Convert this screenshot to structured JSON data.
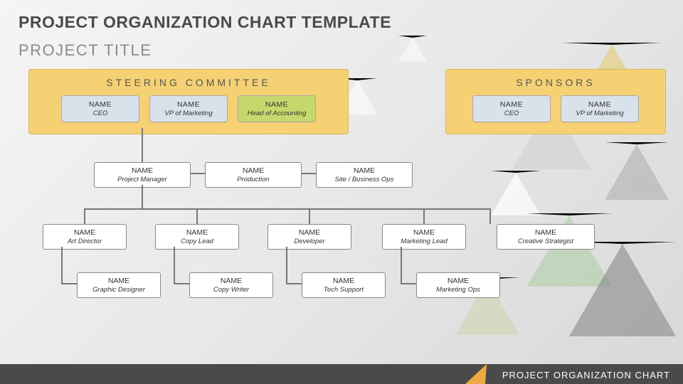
{
  "title": "PROJECT ORGANIZATION CHART TEMPLATE",
  "subtitle": "PROJECT TITLE",
  "steering": {
    "heading": "STEERING COMMITTEE",
    "members": [
      {
        "name": "NAME",
        "role": "CEO"
      },
      {
        "name": "NAME",
        "role": "VP of Marketing"
      },
      {
        "name": "NAME",
        "role": "Head of Accounting"
      }
    ]
  },
  "sponsors": {
    "heading": "SPONSORS",
    "members": [
      {
        "name": "NAME",
        "role": "CEO"
      },
      {
        "name": "NAME",
        "role": "VP of Marketing"
      }
    ]
  },
  "managers": [
    {
      "name": "NAME",
      "role": "Project Manager"
    },
    {
      "name": "NAME",
      "role": "Production"
    },
    {
      "name": "NAME",
      "role": "Site / Business Ops"
    }
  ],
  "leads": [
    {
      "name": "NAME",
      "role": "Art Director"
    },
    {
      "name": "NAME",
      "role": "Copy Lead"
    },
    {
      "name": "NAME",
      "role": "Developer"
    },
    {
      "name": "NAME",
      "role": "Marketing Lead"
    },
    {
      "name": "NAME",
      "role": "Creative Strategist"
    }
  ],
  "staff": [
    {
      "name": "NAME",
      "role": "Graphic Designer"
    },
    {
      "name": "NAME",
      "role": "Copy Writer"
    },
    {
      "name": "NAME",
      "role": "Tech Support"
    },
    {
      "name": "NAME",
      "role": "Marketing Ops"
    }
  ],
  "footer": "PROJECT ORGANIZATION CHART"
}
